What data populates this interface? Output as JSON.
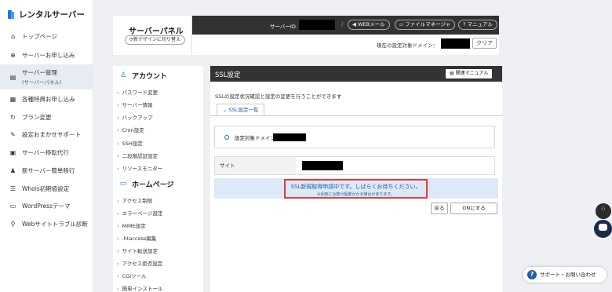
{
  "brand": {
    "name": "レンタルサーバー",
    "color": "#1f7ad6"
  },
  "nav": [
    {
      "label": "トップページ",
      "icon": "home-icon"
    },
    {
      "label": "サーバーお申し込み",
      "icon": "plus-circle-icon"
    },
    {
      "label": "サーバー管理",
      "sub": "(サーバーパネル)",
      "icon": "server-icon",
      "active": true
    },
    {
      "label": "各種特典お申し込み",
      "icon": "gift-icon"
    },
    {
      "label": "プラン変更",
      "icon": "refresh-icon"
    },
    {
      "label": "設定おまかせサポート",
      "icon": "wrench-icon"
    },
    {
      "label": "サーバー移転代行",
      "icon": "transfer-icon"
    },
    {
      "label": "新サーバー簡単移行",
      "icon": "user-move-icon"
    },
    {
      "label": "Whois初期値設定",
      "icon": "document-icon"
    },
    {
      "label": "WordPressテーマ",
      "icon": "window-icon"
    },
    {
      "label": "Webサイトトラブル診断",
      "icon": "diagnosis-icon"
    }
  ],
  "panel": {
    "title": "サーバーパネル",
    "switch_label": "新デザインに切り替え",
    "server_id_label": "サーバーID",
    "webmail": "WEBメール",
    "filemanager": "ファイルマネージャ",
    "manual": "マニュアル",
    "domain_label": "現在の設定対象ドメイン：",
    "clear": "クリア"
  },
  "side": {
    "account_title": "アカウント",
    "account_items": [
      "パスワード変更",
      "サーバー情報",
      "バックアップ",
      "Cron設定",
      "SSH設定",
      "二段階認証設定",
      "リソースモニター"
    ],
    "home_title": "ホームページ",
    "home_items": [
      "アクセス制限",
      "エラーページ設定",
      "MIME設定",
      ".htaccess編集",
      "サイト転送設定",
      "アクセス拒否設定",
      "CGIツール",
      "簡単インストール"
    ]
  },
  "main": {
    "title": "SSL設定",
    "manual_button": "関連マニュアル",
    "description": "SSLの設定状況確認と設定の変更を行うことができます",
    "tab": "SSL設定一覧",
    "domain_label": "設定対象ドメイン",
    "site_label": "サイト",
    "notice_main": "SSL新規取得申請中です。しばらくお待ちください。",
    "notice_sub": "※反映には数分程度かかる場合があります。",
    "back_button": "戻る",
    "on_button": "ONにする"
  },
  "float": {
    "support_label": "サポート・お問い合わせ"
  },
  "colors": {
    "accent": "#1f7ad6",
    "header": "#323232",
    "notice_bg": "#dde9f7",
    "notice_border": "#e23b3b"
  }
}
